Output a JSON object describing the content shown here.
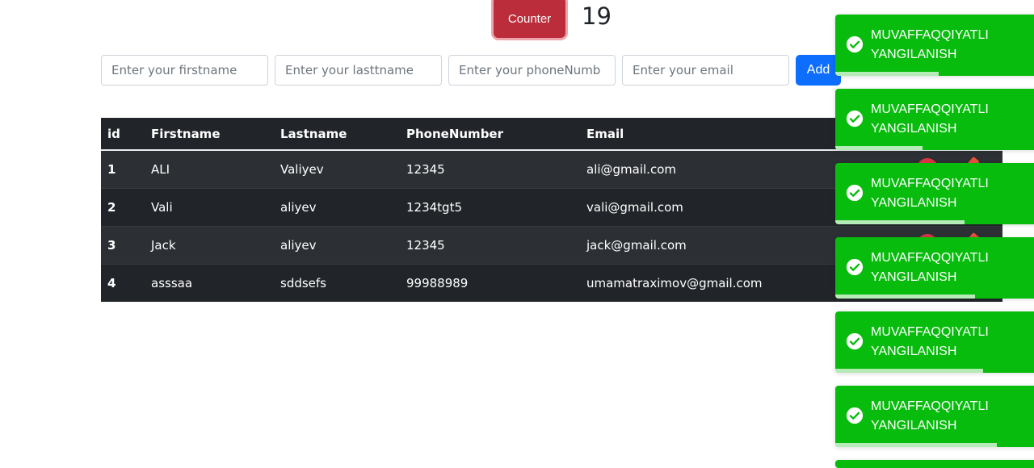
{
  "counter": {
    "button_label": "Counter",
    "value": "19"
  },
  "form": {
    "firstname_placeholder": "Enter your firstname",
    "lastname_placeholder": "Enter your lasttname",
    "phone_placeholder": "Enter your phoneNumb",
    "email_placeholder": "Enter your email",
    "add_label": "Add"
  },
  "table": {
    "headers": [
      "id",
      "Firstname",
      "Lastname",
      "PhoneNumber",
      "Email"
    ],
    "rows": [
      [
        "1",
        "ALI",
        "Valiyev",
        "12345",
        "ali@gmail.com"
      ],
      [
        "2",
        "Vali",
        "aliyev",
        "1234tgt5",
        "vali@gmail.com"
      ],
      [
        "3",
        "Jack",
        "aliyev",
        "12345",
        "jack@gmail.com"
      ],
      [
        "4",
        "asssaa",
        "sddsefs",
        "99988989",
        "umamatraximov@gmail.com"
      ]
    ]
  },
  "toasts": [
    {
      "message": "MUVAFFAQQIYATLI YANGILANISH",
      "progress": 0.51,
      "icon": "check-circle-icon"
    },
    {
      "message": "MUVAFFAQQIYATLI YANGILANISH",
      "progress": 0.43,
      "icon": "check-circle-icon"
    },
    {
      "message": "MUVAFFAQQIYATLI YANGILANISH",
      "progress": 0.64,
      "icon": "check-circle-icon"
    },
    {
      "message": "MUVAFFAQQIYATLI YANGILANISH",
      "progress": 0.69,
      "icon": "check-circle-icon"
    },
    {
      "message": "MUVAFFAQQIYATLI YANGILANISH",
      "progress": 0.73,
      "icon": "check-circle-icon"
    },
    {
      "message": "MUVAFFAQQIYATLI YANGILANISH",
      "progress": 0.8,
      "icon": "check-circle-icon"
    }
  ],
  "colors": {
    "counter_button": "#bb2d3b",
    "add_button": "#0d6efd",
    "table_dark": "#212529",
    "toast_success": "#07bc0c"
  }
}
